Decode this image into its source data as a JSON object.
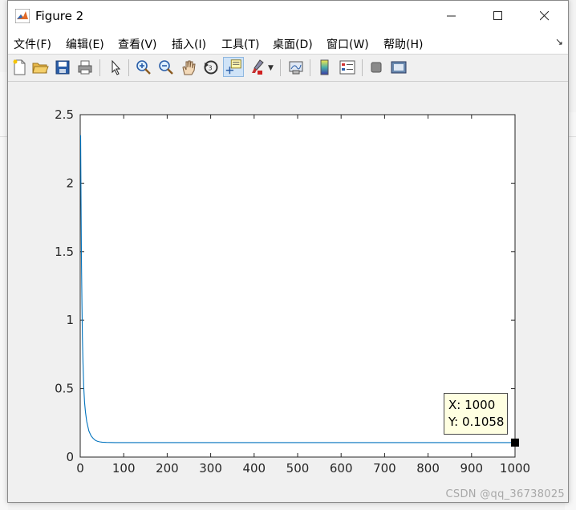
{
  "window": {
    "title": "Figure 2"
  },
  "menus": [
    "文件(F)",
    "编辑(E)",
    "查看(V)",
    "插入(I)",
    "工具(T)",
    "桌面(D)",
    "窗口(W)",
    "帮助(H)"
  ],
  "toolbar": {
    "buttons": [
      "new-figure",
      "open-file",
      "save",
      "print",
      "edit-plot",
      "zoom-in",
      "zoom-out",
      "pan",
      "rotate-3d",
      "data-cursor",
      "brush",
      "link-plot",
      "colorbar",
      "legend",
      "hide-plot-tools",
      "show-plot-tools"
    ],
    "active": "data-cursor"
  },
  "chart_data": {
    "type": "line",
    "xlim": [
      0,
      1000
    ],
    "ylim": [
      0,
      2.5
    ],
    "xticks": [
      "0",
      "100",
      "200",
      "300",
      "400",
      "500",
      "600",
      "700",
      "800",
      "900",
      "1000"
    ],
    "yticks": [
      "0",
      "0.5",
      "1",
      "1.5",
      "2",
      "2.5"
    ],
    "series": [
      {
        "color": "#0072bd",
        "x": [
          1,
          2,
          3,
          4,
          5,
          6,
          8,
          10,
          12,
          15,
          20,
          25,
          30,
          35,
          40,
          45,
          50,
          60,
          80,
          100,
          200,
          400,
          600,
          800,
          1000
        ],
        "y": [
          2.35,
          1.8,
          1.4,
          1.1,
          0.88,
          0.72,
          0.52,
          0.4,
          0.33,
          0.26,
          0.19,
          0.155,
          0.135,
          0.122,
          0.115,
          0.111,
          0.109,
          0.107,
          0.1062,
          0.106,
          0.1058,
          0.1058,
          0.1058,
          0.1058,
          0.1058
        ]
      }
    ],
    "grid": false,
    "datatip": {
      "x": "1000",
      "y": "0.1058",
      "x_label": "X: 1000",
      "y_label": "Y: 0.1058"
    }
  },
  "watermark": "CSDN @qq_36738025"
}
